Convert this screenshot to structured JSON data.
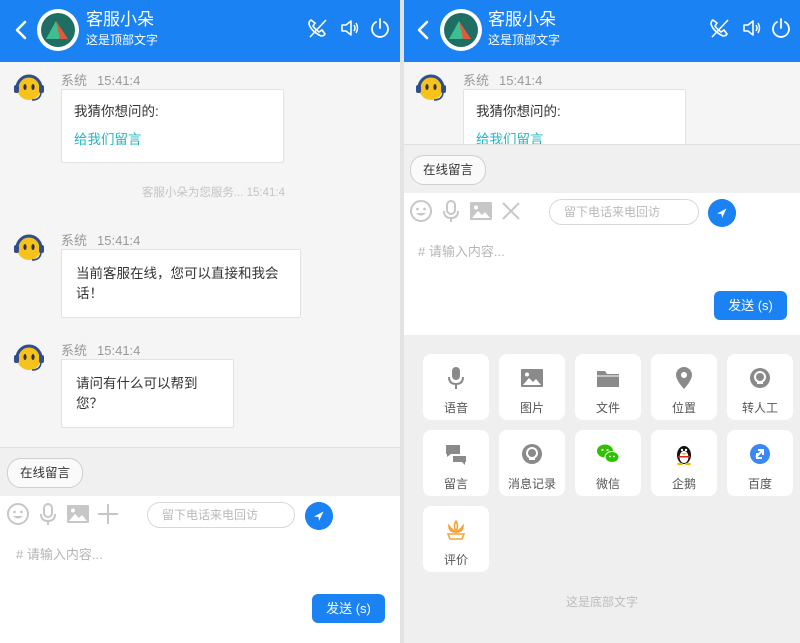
{
  "header": {
    "title": "客服小朵",
    "subtitle": "这是顶部文字"
  },
  "messages": [
    {
      "sender": "系统",
      "time": "15:41:4",
      "text": "我猜你想问的:",
      "link": "给我们留言"
    },
    {
      "sender": "系统",
      "time": "15:41:4",
      "text": "当前客服在线，您可以直接和我会话！"
    },
    {
      "sender": "系统",
      "time": "15:41:4",
      "text": "请问有什么可以帮到您？"
    }
  ],
  "system_note": {
    "text": "客服小朵为您服务... 15:41:4"
  },
  "online_message_label": "在线留言",
  "input": {
    "phone_placeholder": "留下电话来电回访",
    "message_placeholder": "# 请输入内容...",
    "send_label": "发送 (s)"
  },
  "panel": {
    "items": [
      {
        "label": "语音",
        "icon": "mic-icon"
      },
      {
        "label": "图片",
        "icon": "image-icon"
      },
      {
        "label": "文件",
        "icon": "folder-icon"
      },
      {
        "label": "位置",
        "icon": "location-icon"
      },
      {
        "label": "转人工",
        "icon": "transfer-agent-icon"
      },
      {
        "label": "留言",
        "icon": "message-icon"
      },
      {
        "label": "消息记录",
        "icon": "history-icon"
      },
      {
        "label": "微信",
        "icon": "wechat-icon"
      },
      {
        "label": "企鹅",
        "icon": "qq-penguin-icon"
      },
      {
        "label": "百度",
        "icon": "baidu-icon"
      },
      {
        "label": "评价",
        "icon": "rating-icon"
      }
    ],
    "footer": "这是底部文字"
  },
  "colors": {
    "primary": "#1a82f3",
    "link": "#22b6c4",
    "panel_bg": "#efefef"
  }
}
